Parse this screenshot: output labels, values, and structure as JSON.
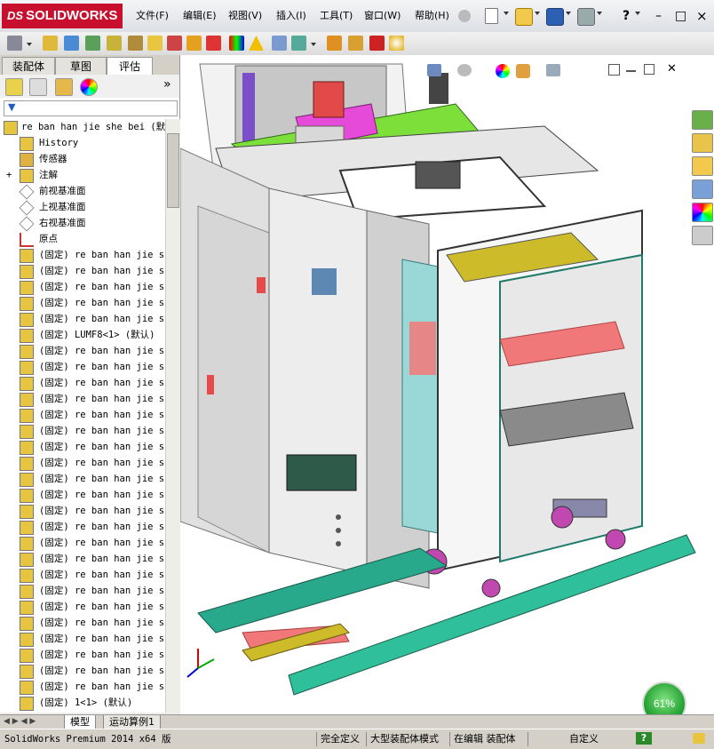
{
  "app": {
    "brand": "SOLIDWORKS",
    "brand_prefix": "DS"
  },
  "menu": [
    "文件(F)",
    "编辑(E)",
    "视图(V)",
    "插入(I)",
    "工具(T)",
    "窗口(W)",
    "帮助(H)"
  ],
  "window_controls": {
    "help": "?",
    "minimize": "–",
    "restore": "□",
    "close": "×"
  },
  "panel_tabs": [
    "装配体",
    "草图",
    "评估"
  ],
  "active_panel_tab": "评估",
  "manager_more": "»",
  "tree": {
    "root": "re ban han jie she bei  (默",
    "items": [
      {
        "label": "History",
        "icon": "history-icon"
      },
      {
        "label": "传感器",
        "icon": "sensor-icon"
      },
      {
        "label": "注解",
        "icon": "annotation-icon",
        "expander": "+"
      },
      {
        "label": "前视基准面",
        "icon": "plane-icon"
      },
      {
        "label": "上视基准面",
        "icon": "plane-icon"
      },
      {
        "label": "右视基准面",
        "icon": "plane-icon"
      },
      {
        "label": "原点",
        "icon": "origin-icon"
      },
      {
        "label": "(固定) re ban han jie sh",
        "icon": "part-icon"
      },
      {
        "label": "(固定) re ban han jie sh",
        "icon": "part-icon"
      },
      {
        "label": "(固定) re ban han jie sh",
        "icon": "part-icon"
      },
      {
        "label": "(固定) re ban han jie sh",
        "icon": "part-icon"
      },
      {
        "label": "(固定) re ban han jie sh",
        "icon": "part-icon"
      },
      {
        "label": "(固定) LUMF8<1> (默认)",
        "icon": "part-icon"
      },
      {
        "label": "(固定) re ban han jie sh",
        "icon": "part-icon"
      },
      {
        "label": "(固定) re ban han jie sh",
        "icon": "part-icon"
      },
      {
        "label": "(固定) re ban han jie sh",
        "icon": "part-icon"
      },
      {
        "label": "(固定) re ban han jie sh",
        "icon": "part-icon"
      },
      {
        "label": "(固定) re ban han jie sh",
        "icon": "part-icon"
      },
      {
        "label": "(固定) re ban han jie sh",
        "icon": "part-icon"
      },
      {
        "label": "(固定) re ban han jie sh",
        "icon": "part-icon"
      },
      {
        "label": "(固定) re ban han jie sh",
        "icon": "part-icon"
      },
      {
        "label": "(固定) re ban han jie sh",
        "icon": "part-icon"
      },
      {
        "label": "(固定) re ban han jie sh",
        "icon": "part-icon"
      },
      {
        "label": "(固定) re ban han jie sh",
        "icon": "part-icon"
      },
      {
        "label": "(固定) re ban han jie sh",
        "icon": "part-icon"
      },
      {
        "label": "(固定) re ban han jie sh",
        "icon": "part-icon"
      },
      {
        "label": "(固定) re ban han jie sh",
        "icon": "part-icon"
      },
      {
        "label": "(固定) re ban han jie sh",
        "icon": "part-icon"
      },
      {
        "label": "(固定) re ban han jie sh",
        "icon": "part-icon"
      },
      {
        "label": "(固定) re ban han jie sh",
        "icon": "part-icon"
      },
      {
        "label": "(固定) re ban han jie sh",
        "icon": "part-icon"
      },
      {
        "label": "(固定) re ban han jie sh",
        "icon": "part-icon"
      },
      {
        "label": "(固定) re ban han jie sh",
        "icon": "part-icon"
      },
      {
        "label": "(固定) re ban han jie sh",
        "icon": "part-icon"
      },
      {
        "label": "(固定) re ban han jie sh",
        "icon": "part-icon"
      },
      {
        "label": "(固定) 1<1> (默认)",
        "icon": "part-icon"
      },
      {
        "label": "(固定) re ban han jie sh",
        "icon": "part-icon"
      }
    ]
  },
  "bottom_tabs": [
    "模型",
    "运动算例1"
  ],
  "status": {
    "product": "SolidWorks Premium 2014 x64 版",
    "definition": "完全定义",
    "mode": "大型装配体模式",
    "editing": "在编辑 装配体",
    "units": "自定义",
    "help": "?"
  },
  "gauge": {
    "value_label": "61%"
  },
  "colors": {
    "brand_red": "#c8102e",
    "frame_green": "#28a98c",
    "deck_green": "#7ddf3a",
    "cabinet_grey": "#e8e8e8",
    "pink_plate": "#f07878"
  }
}
